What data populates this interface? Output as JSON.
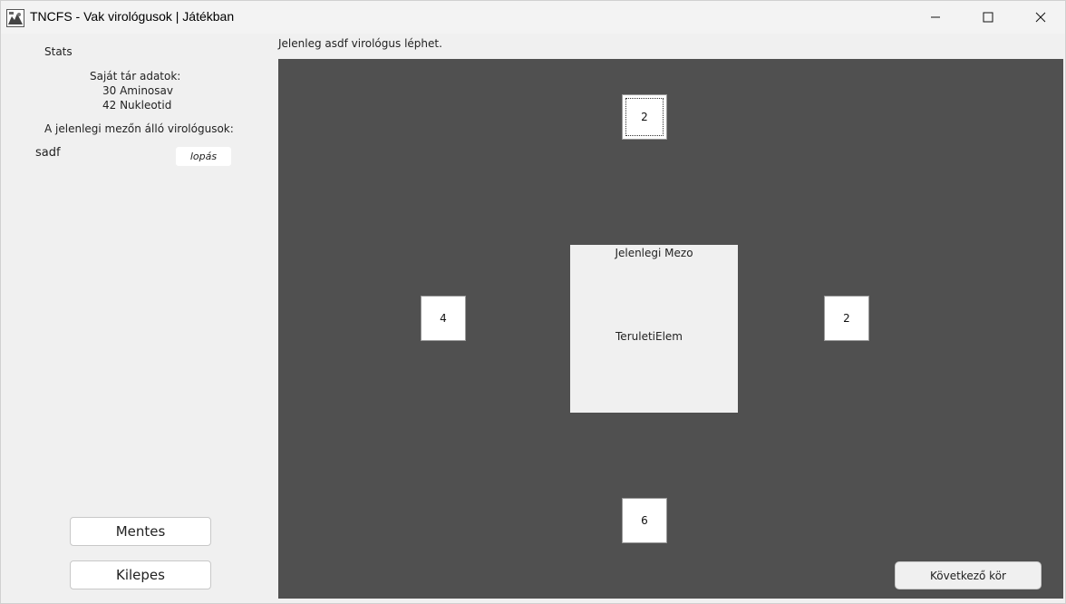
{
  "window": {
    "title": "TNCFS - Vak virológusok | Játékban",
    "icons": {
      "app": "app-icon",
      "minimize": "minimize-icon",
      "maximize": "maximize-icon",
      "close": "close-icon"
    }
  },
  "sidebar": {
    "stats_label": "Stats",
    "storage_title": "Saját tár adatok:",
    "amino": "30 Aminosav",
    "nukleotid": "42 Nukleotid",
    "virologists_title": "A jelenlegi mezőn álló virológusok:",
    "virologists": [
      {
        "name": "sadf",
        "action_label": "lopás"
      }
    ],
    "save_label": "Mentes",
    "exit_label": "Kilepes"
  },
  "status": {
    "text": "Jelenleg asdf virológus léphet."
  },
  "board": {
    "neighbors": {
      "top": "2",
      "left": "4",
      "right": "2",
      "bottom": "6"
    },
    "current_field": {
      "title": "Jelenlegi Mezo",
      "element": "TeruletiElem"
    },
    "next_turn_label": "Következő kör",
    "colors": {
      "board_bg": "#505050",
      "panel_bg": "#f0f0f0"
    }
  }
}
